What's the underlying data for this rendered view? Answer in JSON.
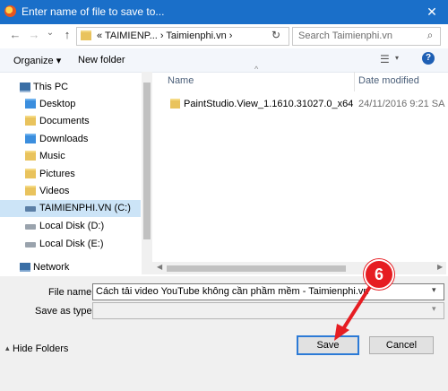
{
  "window": {
    "title": "Enter name of file to save to...",
    "close_glyph": "✕"
  },
  "nav": {
    "back_glyph": "←",
    "forward_glyph": "→",
    "history_glyph": "⌄",
    "up_glyph": "↑",
    "address_text": "« TAIMIENP... › Taimienphi.vn ›",
    "refresh_glyph": "↻",
    "search_placeholder": "Search Taimienphi.vn",
    "search_glyph": "⌕"
  },
  "toolbar": {
    "organize_label": "Organize ▾",
    "new_folder_label": "New folder",
    "view_glyph": "☰",
    "view_caret": "▾",
    "help_glyph": "?"
  },
  "sidebar": {
    "items": [
      {
        "label": "This PC",
        "icon": "computer-icon"
      },
      {
        "label": "Desktop",
        "icon": "folder-icon"
      },
      {
        "label": "Documents",
        "icon": "folder-icon"
      },
      {
        "label": "Downloads",
        "icon": "folder-icon"
      },
      {
        "label": "Music",
        "icon": "folder-icon"
      },
      {
        "label": "Pictures",
        "icon": "folder-icon"
      },
      {
        "label": "Videos",
        "icon": "folder-icon"
      },
      {
        "label": "TAIMIENPHI.VN (C:)",
        "icon": "drive-icon"
      },
      {
        "label": "Local Disk (D:)",
        "icon": "drive-icon"
      },
      {
        "label": "Local Disk (E:)",
        "icon": "drive-icon"
      },
      {
        "label": "Network",
        "icon": "network-icon"
      }
    ]
  },
  "file_list": {
    "columns": [
      "Name",
      "Date modified"
    ],
    "sort_glyph": "^",
    "rows": [
      {
        "name": "PaintStudio.View_1.1610.31027.0_x64",
        "date": "24/11/2016 9:21 SA"
      }
    ]
  },
  "form": {
    "file_name_label": "File name:",
    "file_name_value": "Cách tải video YouTube không cần phầm mềm - Taimienphi.vn",
    "save_as_type_label": "Save as type:",
    "dropdown_glyph": "▾"
  },
  "footer": {
    "hide_folders_label": "Hide Folders",
    "hide_caret": "▴",
    "save_label": "Save",
    "cancel_label": "Cancel"
  },
  "annotation": {
    "step_number": "6",
    "color": "#e61d22"
  }
}
